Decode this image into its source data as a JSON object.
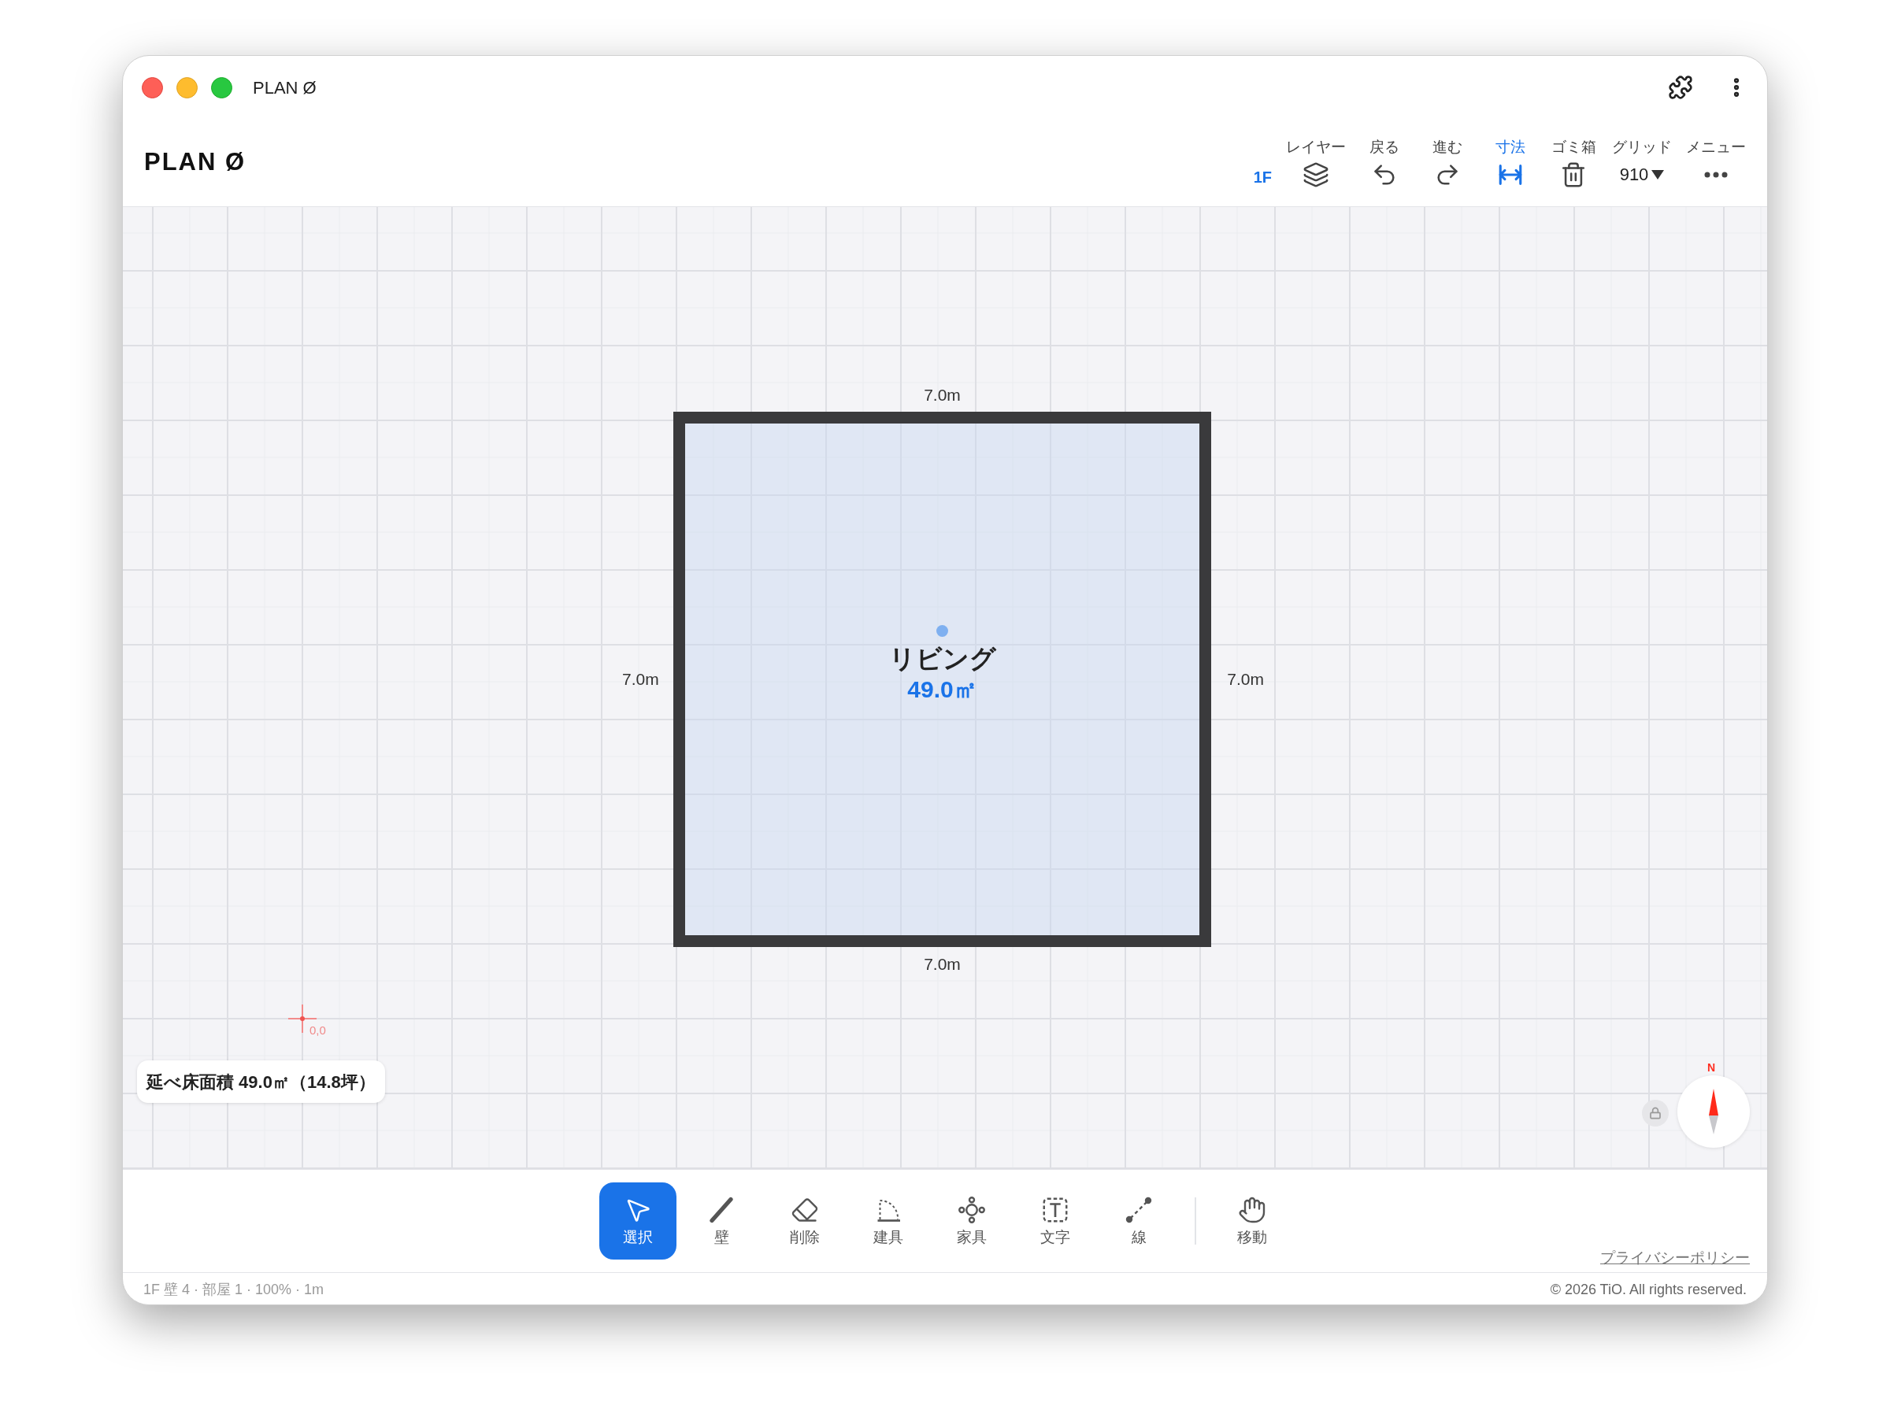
{
  "window": {
    "title": "PLAN Ø"
  },
  "header": {
    "logo": "PLAN Ø",
    "floor": {
      "label": "1F",
      "selected": true
    },
    "tools": [
      {
        "label": "レイヤー",
        "kind": "icon",
        "active": false
      },
      {
        "label": "戻る",
        "kind": "icon",
        "active": false
      },
      {
        "label": "進む",
        "kind": "icon",
        "active": false
      },
      {
        "label": "寸法",
        "kind": "icon",
        "active": true
      },
      {
        "label": "ゴミ箱",
        "kind": "icon",
        "active": false
      },
      {
        "label": "グリッド",
        "kind": "select",
        "value": "910",
        "active": false
      },
      {
        "label": "メニュー",
        "kind": "icon",
        "active": false
      }
    ]
  },
  "canvas": {
    "room": {
      "name": "リビング",
      "area": "49.0㎡",
      "dimensions": {
        "top": "7.0m",
        "left": "7.0m",
        "right": "7.0m",
        "bottom": "7.0m"
      }
    },
    "origin_label": "0,0",
    "floor_area": "延べ床面積 49.0㎡（14.8坪）",
    "compass": {
      "north_label": "N"
    },
    "locked": true
  },
  "toolbar": [
    {
      "label": "選択",
      "selected": true,
      "separator_before": false
    },
    {
      "label": "壁",
      "selected": false,
      "separator_before": false
    },
    {
      "label": "削除",
      "selected": false,
      "separator_before": false
    },
    {
      "label": "建具",
      "selected": false,
      "separator_before": false
    },
    {
      "label": "家具",
      "selected": false,
      "separator_before": false
    },
    {
      "label": "文字",
      "selected": false,
      "separator_before": false
    },
    {
      "label": "線",
      "selected": false,
      "separator_before": false
    },
    {
      "label": "移動",
      "selected": false,
      "separator_before": true
    }
  ],
  "footer": {
    "privacy_link": "プライバシーポリシー",
    "status": "1F 壁 4 · 部屋 1 · 100% · 1m",
    "copyright": "© 2026 TiO. All rights reserved."
  }
}
